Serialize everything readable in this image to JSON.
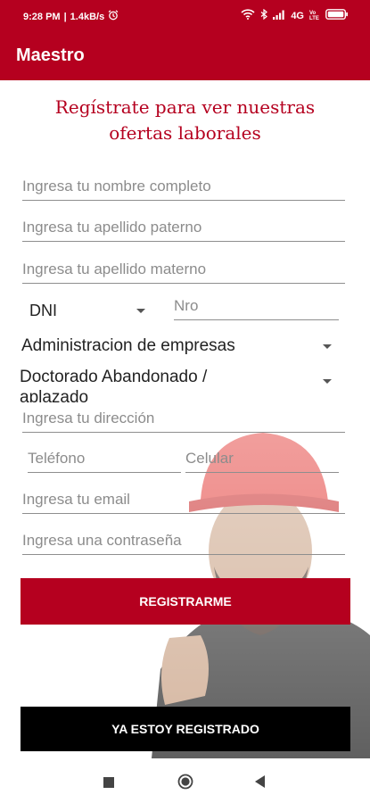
{
  "status_bar": {
    "time": "9:28 PM",
    "speed": "1.4kB/s",
    "network": "4G",
    "volte": "Vo LTE"
  },
  "app_bar": {
    "title": "Maestro"
  },
  "heading": "Regístrate para ver nuestras ofertas laborales",
  "form": {
    "full_name_placeholder": "Ingresa tu nombre completo",
    "paternal_surname_placeholder": "Ingresa tu apellido paterno",
    "maternal_surname_placeholder": "Ingresa tu apellido materno",
    "document_type": "DNI",
    "document_number_placeholder": "Nro",
    "career": "Administracion de empresas",
    "education_level": "Doctorado Abandonado / aplazado",
    "address_placeholder": "Ingresa tu dirección",
    "phone_placeholder": "Teléfono",
    "mobile_placeholder": "Celular",
    "email_placeholder": "Ingresa tu email",
    "password_placeholder": "Ingresa una contraseña"
  },
  "buttons": {
    "register": "REGISTRARME",
    "already_registered": "YA ESTOY REGISTRADO"
  },
  "icons": [
    "alarm-icon",
    "wifi-icon",
    "bluetooth-icon",
    "signal-icon",
    "battery-icon",
    "chevron-down-icon",
    "recent-apps-icon",
    "home-icon",
    "back-icon"
  ],
  "colors": {
    "primary": "#b5001f",
    "dark_button": "#000000",
    "background": "#ffffff"
  }
}
